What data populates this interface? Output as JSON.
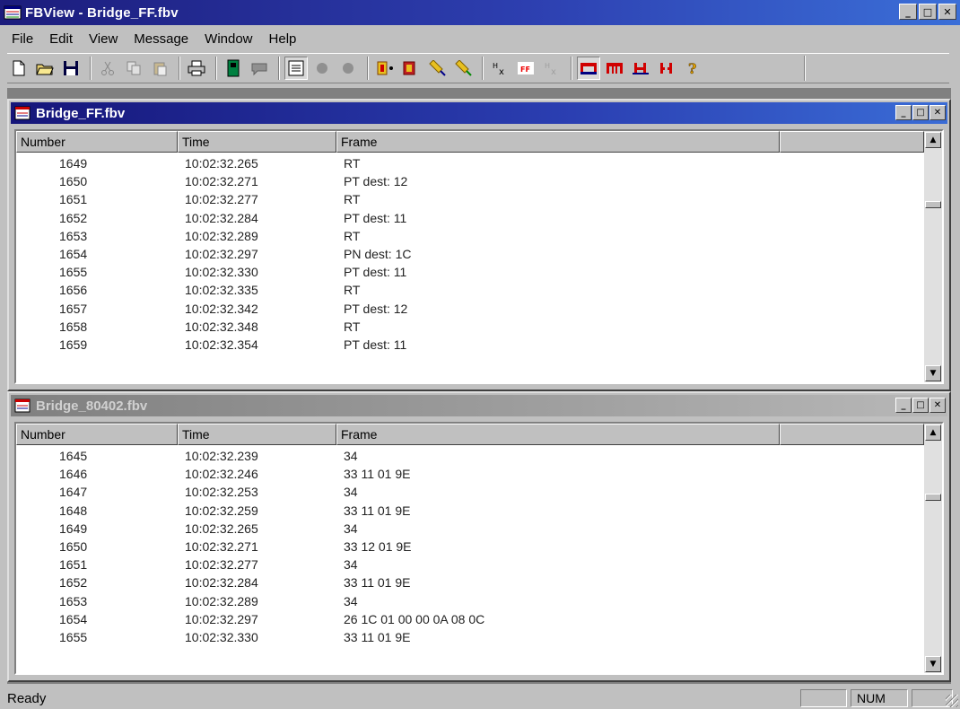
{
  "window": {
    "title": "FBView - Bridge_FF.fbv"
  },
  "menu": [
    "File",
    "Edit",
    "View",
    "Message",
    "Window",
    "Help"
  ],
  "toolbar": {
    "icons": [
      "new-file-icon",
      "open-folder-icon",
      "save-icon",
      "cut-icon",
      "copy-icon",
      "paste-icon",
      "print-icon",
      "book-icon",
      "flag-icon",
      "list-view-icon",
      "gray-circle-icon",
      "gray-circle-icon",
      "network-node-icon",
      "network-node-red-icon",
      "probe-icon",
      "probe-out-icon",
      "hex-icon",
      "ff-icon",
      "hex-disabled-icon",
      "bridge-icon",
      "bridge-dashed-icon",
      "bridge-red-icon",
      "bridge-red-dashed-icon",
      "help-icon"
    ]
  },
  "windows": [
    {
      "title": "Bridge_FF.fbv",
      "active": true,
      "columns": [
        "Number",
        "Time",
        "Frame",
        ""
      ],
      "rows": [
        [
          "1649",
          "10:02:32.265",
          "RT"
        ],
        [
          "1650",
          "10:02:32.271",
          "PT dest: 12"
        ],
        [
          "1651",
          "10:02:32.277",
          "RT"
        ],
        [
          "1652",
          "10:02:32.284",
          "PT dest: 11"
        ],
        [
          "1653",
          "10:02:32.289",
          "RT"
        ],
        [
          "1654",
          "10:02:32.297",
          "PN dest: 1C"
        ],
        [
          "1655",
          "10:02:32.330",
          "PT dest: 11"
        ],
        [
          "1656",
          "10:02:32.335",
          "RT"
        ],
        [
          "1657",
          "10:02:32.342",
          "PT dest: 12"
        ],
        [
          "1658",
          "10:02:32.348",
          "RT"
        ],
        [
          "1659",
          "10:02:32.354",
          "PT dest: 11"
        ]
      ],
      "scroll_position": 0.25
    },
    {
      "title": "Bridge_80402.fbv",
      "active": false,
      "columns": [
        "Number",
        "Time",
        "Frame",
        ""
      ],
      "rows": [
        [
          "1645",
          "10:02:32.239",
          "34"
        ],
        [
          "1646",
          "10:02:32.246",
          "33 11 01 9E"
        ],
        [
          "1647",
          "10:02:32.253",
          "34"
        ],
        [
          "1648",
          "10:02:32.259",
          "33 11 01 9E"
        ],
        [
          "1649",
          "10:02:32.265",
          "34"
        ],
        [
          "1650",
          "10:02:32.271",
          "33 12 01 9E"
        ],
        [
          "1651",
          "10:02:32.277",
          "34"
        ],
        [
          "1652",
          "10:02:32.284",
          "33 11 01 9E"
        ],
        [
          "1653",
          "10:02:32.289",
          "34"
        ],
        [
          "1654",
          "10:02:32.297",
          "26 1C 01 00 00 0A 08 0C"
        ],
        [
          "1655",
          "10:02:32.330",
          "33 11 01 9E"
        ]
      ],
      "scroll_position": 0.25
    }
  ],
  "status": {
    "text": "Ready",
    "panels": [
      "",
      "NUM",
      ""
    ]
  },
  "colors": {
    "title_active": "#1c1c7c",
    "title_inactive": "#808080",
    "face": "#c0c0c0"
  }
}
